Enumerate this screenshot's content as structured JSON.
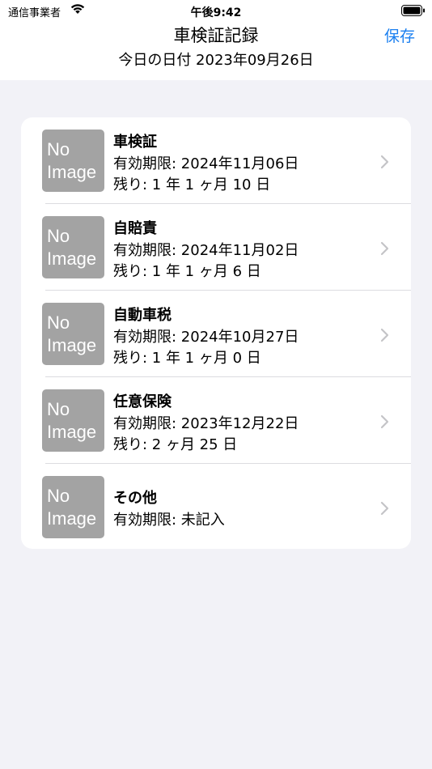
{
  "status_bar": {
    "carrier": "通信事業者",
    "time": "午後9:42"
  },
  "nav": {
    "title": "車検証記録",
    "date_line": "今日の日付  2023年09月26日",
    "save_label": "保存"
  },
  "placeholder_text": [
    "No",
    "Image"
  ],
  "items": [
    {
      "title": "車検証",
      "expiry": "有効期限:  2024年11月06日",
      "remaining": "残り: 1 年 1 ヶ月 10 日"
    },
    {
      "title": "自賠責",
      "expiry": "有効期限:  2024年11月02日",
      "remaining": "残り: 1 年 1 ヶ月 6 日"
    },
    {
      "title": "自動車税",
      "expiry": "有効期限:  2024年10月27日",
      "remaining": "残り: 1 年 1 ヶ月 0 日"
    },
    {
      "title": "任意保険",
      "expiry": "有効期限:  2023年12月22日",
      "remaining": "残り: 2 ヶ月 25 日"
    },
    {
      "title": "その他",
      "expiry": "有効期限:  未記入",
      "remaining": ""
    }
  ],
  "colors": {
    "accent": "#1a7ff0",
    "background": "#f2f2f7",
    "thumbnail": "#a3a3a3",
    "chevron": "#c4c4c7"
  },
  "icons": [
    "wifi-icon",
    "battery-icon",
    "chevron-right-icon"
  ]
}
